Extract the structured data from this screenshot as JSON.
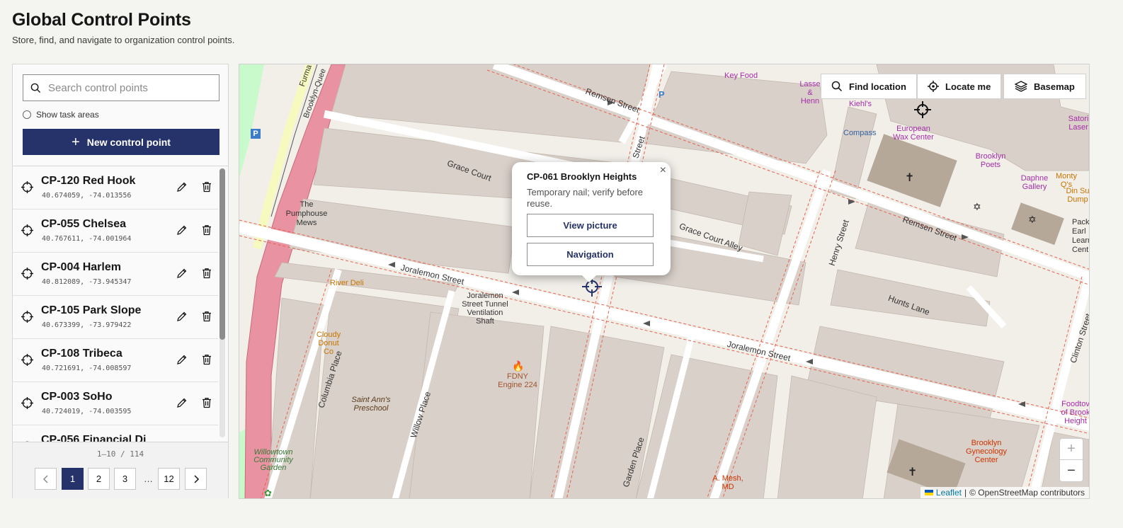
{
  "page": {
    "title": "Global Control Points",
    "subtitle": "Store, find, and navigate to organization control points."
  },
  "sidebar": {
    "search_placeholder": "Search control points",
    "show_task_areas_label": "Show task areas",
    "new_button_label": "New control point",
    "items": [
      {
        "name": "CP-120 Red Hook",
        "coords": "40.674059, -74.013556"
      },
      {
        "name": "CP-055 Chelsea",
        "coords": "40.767611, -74.001964"
      },
      {
        "name": "CP-004 Harlem",
        "coords": "40.812089, -73.945347"
      },
      {
        "name": "CP-105 Park Slope",
        "coords": "40.673399, -73.979422"
      },
      {
        "name": "CP-108 Tribeca",
        "coords": "40.721691, -74.008597"
      },
      {
        "name": "CP-003 SoHo",
        "coords": "40.724019, -74.003595"
      },
      {
        "name": "CP-056 Financial Di",
        "coords": ""
      }
    ],
    "pagination": {
      "info": "1–10 / 114",
      "pages": [
        "1",
        "2",
        "3",
        "12"
      ],
      "ellipsis": "…",
      "current": "1"
    }
  },
  "map": {
    "buttons": {
      "find_location": "Find location",
      "locate_me": "Locate me",
      "basemap": "Basemap"
    },
    "popup": {
      "title": "CP-061 Brooklyn Heights",
      "description": "Temporary nail; verify before reuse.",
      "view_picture": "View picture",
      "navigation": "Navigation",
      "close": "×"
    },
    "zoom": {
      "in": "+",
      "out": "−"
    },
    "attribution": {
      "leaflet": "Leaflet",
      "separator": "|",
      "osm": "© OpenStreetMap contributors"
    },
    "streets": {
      "remsen_1": "Remsen Street",
      "remsen_2": "Remsen Street",
      "grace_court": "Grace Court",
      "grace_court_alley": "Grace Court Alley",
      "joralemon_1": "Joralemon Street",
      "joralemon_2": "Joralemon Street",
      "hunts_lane": "Hunts Lane",
      "henry_street": "Henry Street",
      "clinton_street": "Clinton Street",
      "columbia_place": "Columbia Place",
      "willow_place": "Willow Place",
      "garden_place": "Garden Place",
      "hicks_street": "Street",
      "furman": "Furma",
      "bqe": "Brooklyn-Quee"
    },
    "places": {
      "pumphouse": "The Pumphouse Mews",
      "river_deli": "River Deli",
      "cloudy_donut": "Cloudy Donut Co",
      "saint_anns": "Saint Ann's Preschool",
      "joralemon_shaft": "Joralemon Street Tunnel Ventilation Shaft",
      "fdny": "FDNY Engine 224",
      "willowtown": "Willowtown Community Garden",
      "key_food": "Key Food",
      "lasse": "Lasse & Henn",
      "kiehls": "Kiehl's",
      "compass": "Compass",
      "european_wax": "European Wax Center",
      "brooklyn_poets": "Brooklyn Poets",
      "daphne": "Daphne Gallery",
      "monty_q": "Monty Q's",
      "satori": "Satori Laser",
      "din_su": "Din Su Dump",
      "packer": "Pack Earl Learn Cent",
      "gynecology": "Brooklyn Gynecology Center",
      "mesh": "A. Mesh, MD",
      "foodtown": "Foodtov of Brook Height"
    },
    "colors": {
      "water_road": "#e892a2",
      "building": "#d9d0c9",
      "land": "#f2efe9",
      "park": "#c8facc",
      "accent": "#26336a"
    }
  }
}
